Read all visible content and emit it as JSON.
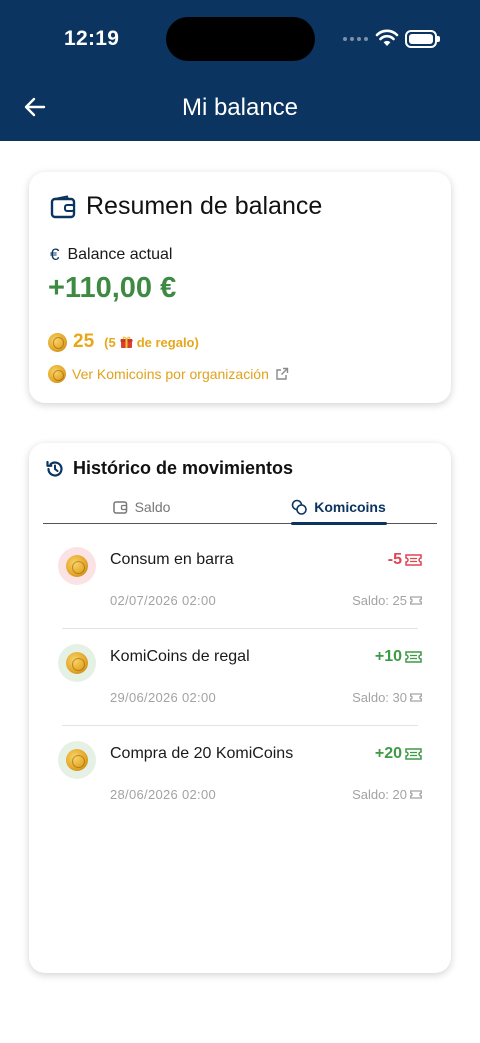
{
  "status_bar": {
    "time": "12:19"
  },
  "header": {
    "title": "Mi balance"
  },
  "summary": {
    "title": "Resumen de balance",
    "balance_label": "Balance actual",
    "balance_value": "+110,00 €",
    "coins_count": "25",
    "coins_gift_prefix": "(5",
    "coins_gift_suffix": "de regalo)",
    "org_link": "Ver Komicoins por organización"
  },
  "history": {
    "title": "Histórico de movimientos",
    "tabs": [
      {
        "label": "Saldo",
        "active": false
      },
      {
        "label": "Komicoins",
        "active": true
      }
    ],
    "movements": [
      {
        "description": "Consum en barra",
        "amount": "-5",
        "date": "02/07/2026 02:00",
        "saldo": "Saldo: 25",
        "kind": "neg"
      },
      {
        "description": "KomiCoins de regal",
        "amount": "+10",
        "date": "29/06/2026 02:00",
        "saldo": "Saldo: 30",
        "kind": "pos"
      },
      {
        "description": "Compra de 20 KomiCoins",
        "amount": "+20",
        "date": "28/06/2026 02:00",
        "saldo": "Saldo: 20",
        "kind": "pos"
      }
    ]
  },
  "colors": {
    "header_bg": "#0b3460",
    "positive": "#3e8a43",
    "negative": "#e04452",
    "coin_accent": "#e8a71a"
  }
}
